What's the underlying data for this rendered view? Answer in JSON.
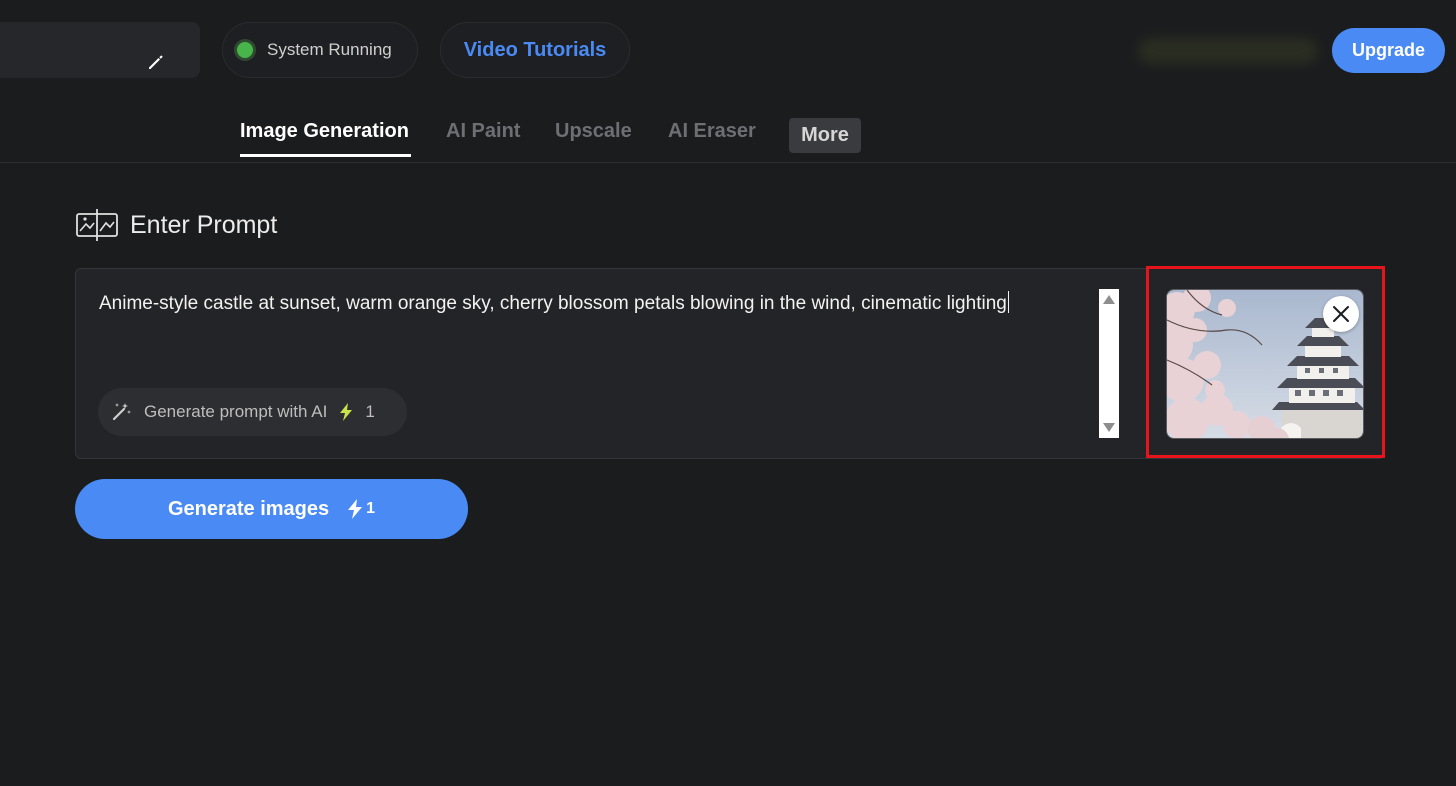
{
  "header": {
    "project_name": "",
    "status_text": "System Running",
    "status_color": "#47b54a",
    "tutorials_label": "Video Tutorials",
    "upgrade_label": "Upgrade",
    "accent_color": "#4a8af4"
  },
  "tabs": [
    {
      "label": "Image Generation",
      "active": true
    },
    {
      "label": "AI Paint",
      "active": false
    },
    {
      "label": "Upscale",
      "active": false
    },
    {
      "label": "AI Eraser",
      "active": false
    },
    {
      "label": "More",
      "active": false
    }
  ],
  "prompt": {
    "section_title": "Enter Prompt",
    "section_icon": "image-compare-icon",
    "text": "Anime-style castle at sunset, warm orange sky, cherry blossom petals blowing in the wind, cinematic lighting",
    "ai_button_label": "Generate prompt with AI",
    "ai_button_cost": "1",
    "reference_image": "japanese-castle-cherry-blossom",
    "close_icon": "close-icon"
  },
  "generate": {
    "label": "Generate images",
    "cost": "1",
    "icon": "lightning-bolt-icon"
  },
  "highlight_color": "#e8141c"
}
